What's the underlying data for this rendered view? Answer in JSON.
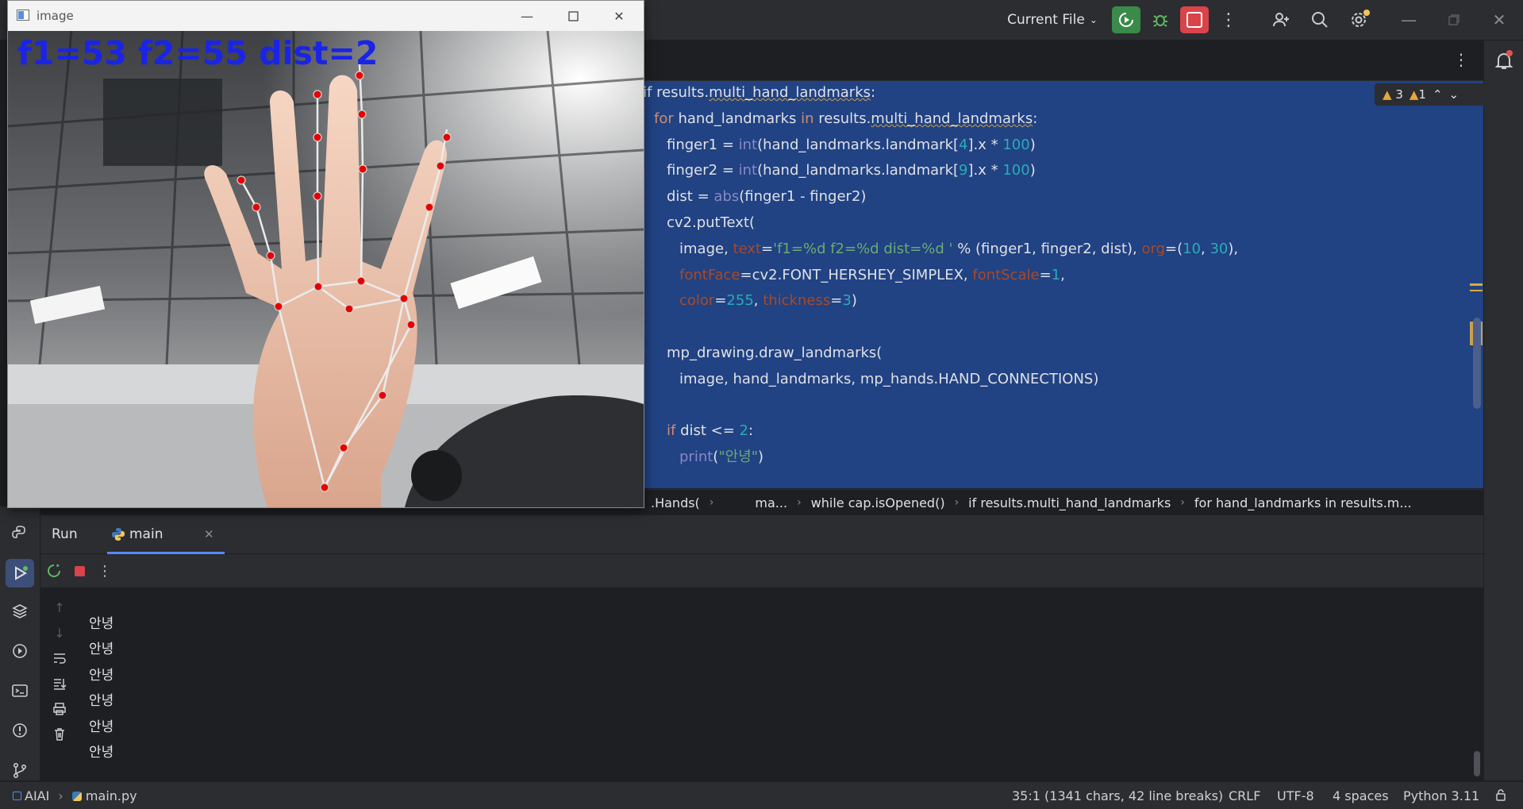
{
  "titlebar": {
    "run_config": "Current File"
  },
  "editor": {
    "inspections": {
      "warnings": "3",
      "weak_warnings": "1"
    },
    "lines": [
      [
        [
          "",
          "if "
        ],
        [
          "",
          "results."
        ],
        [
          "wavy",
          "multi_hand_landmarks"
        ],
        [
          "",
          ":"
        ]
      ],
      [
        [
          "kw",
          "for "
        ],
        [
          "",
          "hand_landmarks "
        ],
        [
          "kw",
          "in "
        ],
        [
          "",
          "results."
        ],
        [
          "wavy",
          "multi_hand_landmarks"
        ],
        [
          "",
          ":"
        ]
      ],
      [
        [
          "",
          "finger1 = "
        ],
        [
          "fn",
          "int"
        ],
        [
          "",
          "(hand_landmarks.landmark["
        ],
        [
          "num",
          "4"
        ],
        [
          "",
          "].x * "
        ],
        [
          "num",
          "100"
        ],
        [
          "",
          ")"
        ]
      ],
      [
        [
          "",
          "finger2 = "
        ],
        [
          "fn",
          "int"
        ],
        [
          "",
          "(hand_landmarks.landmark["
        ],
        [
          "num",
          "9"
        ],
        [
          "",
          "].x * "
        ],
        [
          "num",
          "100"
        ],
        [
          "",
          ")"
        ]
      ],
      [
        [
          "",
          "dist = "
        ],
        [
          "fn",
          "abs"
        ],
        [
          "",
          "(finger1 - finger2)"
        ]
      ],
      [
        [
          "",
          "cv2.putText("
        ]
      ],
      [
        [
          "",
          "image, "
        ],
        [
          "param",
          "text"
        ],
        [
          "",
          "="
        ],
        [
          "str",
          "'f1=%d f2=%d dist=%d '"
        ],
        [
          "",
          " % (finger1, finger2, dist), "
        ],
        [
          "param",
          "org"
        ],
        [
          "",
          "=("
        ],
        [
          "num",
          "10"
        ],
        [
          "",
          ", "
        ],
        [
          "num",
          "30"
        ],
        [
          "",
          "),"
        ]
      ],
      [
        [
          "param",
          "fontFace"
        ],
        [
          "",
          "=cv2.FONT_HERSHEY_SIMPLEX, "
        ],
        [
          "param",
          "fontScale"
        ],
        [
          "",
          "="
        ],
        [
          "num",
          "1"
        ],
        [
          "",
          ","
        ]
      ],
      [
        [
          "param",
          "color"
        ],
        [
          "",
          "="
        ],
        [
          "num",
          "255"
        ],
        [
          "",
          ", "
        ],
        [
          "param",
          "thickness"
        ],
        [
          "",
          "="
        ],
        [
          "num",
          "3"
        ],
        [
          "",
          ")"
        ]
      ],
      [],
      [
        [
          "",
          "mp_drawing.draw_landmarks("
        ]
      ],
      [
        [
          "",
          "image, hand_landmarks, mp_hands.HAND_CONNECTIONS)"
        ]
      ],
      [],
      [
        [
          "kw",
          "if "
        ],
        [
          "",
          "dist <= "
        ],
        [
          "num",
          "2"
        ],
        [
          "",
          ":"
        ]
      ],
      [
        [
          "fn",
          "print"
        ],
        [
          "",
          "("
        ],
        [
          "str",
          "\"안녕\""
        ],
        [
          "",
          ")"
        ]
      ]
    ]
  },
  "breadcrumbs": [
    ".Hands(",
    "ma...",
    "while cap.isOpened()",
    "if results.multi_hand_landmarks",
    "for hand_landmarks in results.m..."
  ],
  "run": {
    "title": "Run",
    "tab_label": "main",
    "output": [
      "안녕",
      "안녕",
      "안녕",
      "안녕",
      "안녕",
      "안녕"
    ]
  },
  "statusbar": {
    "project": "AIAI",
    "file": "main.py",
    "position": "35:1 (1341 chars, 42 line breaks)",
    "line_sep": "CRLF",
    "encoding": "UTF-8",
    "indent": "4 spaces",
    "interpreter": "Python 3.11"
  },
  "cv_window": {
    "title": "image",
    "overlay_text": "f1=53  f2=55  dist=2"
  },
  "colors": {
    "selection": "#214283",
    "run_green": "#3a8a4a",
    "stop_red": "#d9434a",
    "overlay_blue": "#1a24e6",
    "landmark_red": "#e60000"
  }
}
